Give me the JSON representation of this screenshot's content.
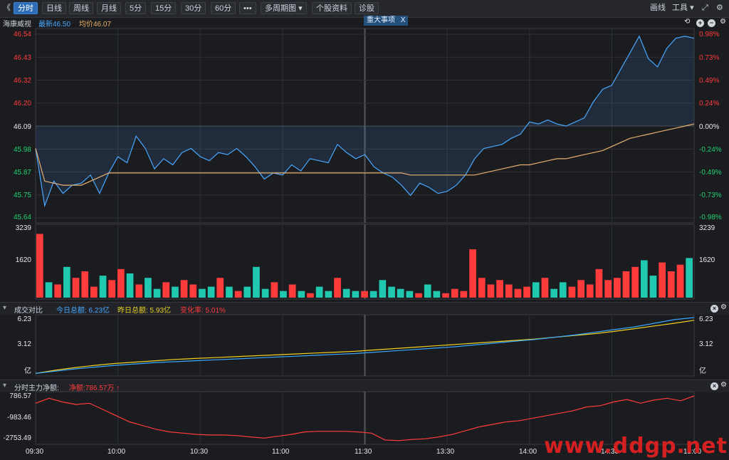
{
  "toolbar": {
    "back": "《",
    "tabs": [
      "分时",
      "日线",
      "周线",
      "月线",
      "5分",
      "15分",
      "30分",
      "60分"
    ],
    "more": "•••",
    "multi_period": "多周期图",
    "stock_info": "个股资料",
    "diagnose": "诊股",
    "draw": "画线",
    "tools": "工具"
  },
  "stock": {
    "name": "海康威视",
    "latest": "最新46.50",
    "avg": "均价46.07",
    "event": "重大事项",
    "event_close": "X"
  },
  "price_axis": {
    "left": [
      "46.54",
      "46.43",
      "46.32",
      "46.20",
      "46.09",
      "45.98",
      "45.87",
      "45.75",
      "45.64"
    ],
    "right": [
      "0.98%",
      "0.73%",
      "0.49%",
      "0.24%",
      "0.00%",
      "-0.24%",
      "-0.49%",
      "-0.73%",
      "-0.98%"
    ]
  },
  "volume_axis": {
    "top": "3239",
    "mid": "1620"
  },
  "turnover_panel": {
    "title": "成交对比",
    "today": "今日总额: 6.23亿",
    "yesterday": "昨日总额: 5.93亿",
    "change": "变化率: 5.01%",
    "axis": [
      "6.23",
      "3.12",
      "亿"
    ]
  },
  "capital_panel": {
    "title": "分时主力净额:",
    "net": "净额:786.57万",
    "axis": [
      "786.57",
      "-983.46",
      "-2753.49"
    ]
  },
  "time_axis": [
    "09:30",
    "10:00",
    "10:30",
    "11:00",
    "11:30",
    "13:30",
    "14:00",
    "14:30",
    "15:00"
  ],
  "watermark": "www.ddgp.net",
  "colors": {
    "price": "#48a8ff",
    "avg": "#e8b070",
    "up": "#ff3b3b",
    "down": "#20c8b0",
    "today": "#3aa8ff",
    "yesterday": "#f0d020",
    "net": "#ff3b3b"
  },
  "chart_data": {
    "type": "line",
    "x_range": [
      "09:30",
      "15:00"
    ],
    "price_ylim": [
      45.64,
      46.54
    ],
    "prev_close": 46.09,
    "price": [
      45.98,
      45.7,
      45.82,
      45.76,
      45.8,
      45.81,
      45.85,
      45.76,
      45.86,
      45.94,
      45.91,
      46.04,
      45.98,
      45.88,
      45.93,
      45.9,
      45.96,
      45.98,
      45.94,
      45.92,
      45.96,
      45.95,
      45.98,
      45.94,
      45.89,
      45.83,
      45.86,
      45.85,
      45.9,
      45.87,
      45.93,
      45.92,
      45.91,
      46.0,
      45.96,
      45.93,
      45.95,
      45.89,
      45.86,
      45.84,
      45.8,
      45.75,
      45.81,
      45.79,
      45.76,
      45.77,
      45.8,
      45.85,
      45.93,
      45.98,
      45.99,
      46.0,
      46.03,
      46.05,
      46.11,
      46.1,
      46.12,
      46.1,
      46.09,
      46.11,
      46.13,
      46.21,
      46.27,
      46.29,
      46.37,
      46.45,
      46.53,
      46.42,
      46.38,
      46.47,
      46.52,
      46.53,
      46.52
    ],
    "avg": [
      45.98,
      45.82,
      45.81,
      45.8,
      45.8,
      45.8,
      45.82,
      45.84,
      45.86,
      45.86,
      45.86,
      45.86,
      45.86,
      45.86,
      45.86,
      45.86,
      45.86,
      45.86,
      45.86,
      45.86,
      45.86,
      45.86,
      45.86,
      45.86,
      45.86,
      45.86,
      45.86,
      45.86,
      45.86,
      45.86,
      45.86,
      45.86,
      45.86,
      45.86,
      45.86,
      45.86,
      45.86,
      45.86,
      45.86,
      45.86,
      45.86,
      45.85,
      45.85,
      45.85,
      45.85,
      45.85,
      45.85,
      45.85,
      45.85,
      45.86,
      45.87,
      45.88,
      45.89,
      45.9,
      45.9,
      45.91,
      45.92,
      45.93,
      45.93,
      45.94,
      45.95,
      45.96,
      45.97,
      45.99,
      46.01,
      46.03,
      46.04,
      46.05,
      46.06,
      46.07,
      46.08,
      46.09,
      46.1
    ],
    "volume": [
      2900,
      700,
      600,
      1400,
      900,
      1200,
      500,
      1000,
      800,
      1300,
      1100,
      600,
      900,
      400,
      700,
      500,
      800,
      600,
      400,
      500,
      900,
      500,
      300,
      500,
      1400,
      400,
      700,
      300,
      600,
      300,
      200,
      500,
      300,
      900,
      400,
      300,
      300,
      300,
      800,
      500,
      400,
      300,
      200,
      600,
      300,
      200,
      400,
      300,
      2200,
      900,
      600,
      800,
      600,
      400,
      500,
      700,
      900,
      400,
      700,
      500,
      800,
      600,
      1300,
      800,
      900,
      1200,
      1400,
      1700,
      1000,
      1600,
      1200,
      1500,
      1800
    ],
    "turnover_today": [
      0.05,
      0.3,
      0.55,
      0.75,
      0.95,
      1.1,
      1.25,
      1.35,
      1.45,
      1.55,
      1.65,
      1.75,
      1.85,
      1.95,
      2.05,
      2.15,
      2.25,
      2.4,
      2.55,
      2.7,
      2.85,
      3.0,
      3.2,
      3.4,
      3.6,
      3.8,
      4.05,
      4.3,
      4.6,
      4.9,
      5.2,
      5.6,
      6.0,
      6.23
    ],
    "turnover_yesterday": [
      0.05,
      0.4,
      0.7,
      0.95,
      1.15,
      1.3,
      1.45,
      1.6,
      1.7,
      1.8,
      1.9,
      2.0,
      2.1,
      2.2,
      2.3,
      2.4,
      2.5,
      2.65,
      2.8,
      2.95,
      3.1,
      3.25,
      3.4,
      3.55,
      3.7,
      3.85,
      4.05,
      4.25,
      4.45,
      4.7,
      5.0,
      5.3,
      5.6,
      5.93
    ],
    "capital_ylim": [
      -2753.49,
      786.57
    ],
    "capital_net": [
      200,
      600,
      300,
      100,
      200,
      -300,
      -800,
      -1300,
      -1600,
      -1900,
      -2100,
      -2200,
      -2300,
      -2350,
      -2350,
      -2400,
      -2500,
      -2600,
      -2450,
      -2300,
      -2100,
      -2050,
      -2050,
      -2050,
      -2100,
      -2200,
      -2750,
      -2800,
      -2700,
      -2650,
      -2500,
      -2300,
      -2000,
      -1700,
      -1500,
      -1300,
      -1200,
      -1000,
      -800,
      -600,
      -400,
      -100,
      0,
      300,
      500,
      200,
      450,
      600,
      400,
      786.57
    ]
  }
}
